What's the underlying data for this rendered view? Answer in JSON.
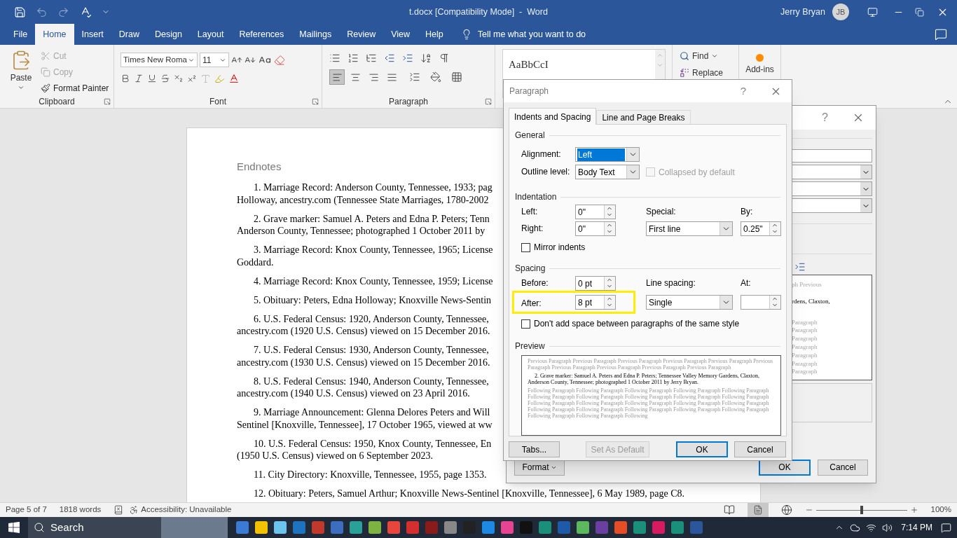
{
  "window": {
    "title": "t.docx [Compatibility Mode]  -  Word",
    "user": "Jerry Bryan",
    "avatar": "JB"
  },
  "ribbon_tabs": [
    {
      "label": "File",
      "selected": false
    },
    {
      "label": "Home",
      "selected": true
    },
    {
      "label": "Insert",
      "selected": false
    },
    {
      "label": "Draw",
      "selected": false
    },
    {
      "label": "Design",
      "selected": false
    },
    {
      "label": "Layout",
      "selected": false
    },
    {
      "label": "References",
      "selected": false
    },
    {
      "label": "Mailings",
      "selected": false
    },
    {
      "label": "Review",
      "selected": false
    },
    {
      "label": "View",
      "selected": false
    },
    {
      "label": "Help",
      "selected": false
    }
  ],
  "tell_me": "Tell me what you want to do",
  "clipboard": {
    "paste": "Paste",
    "cut": {
      "label": "Cut",
      "disabled": true
    },
    "copy": {
      "label": "Copy",
      "disabled": true
    },
    "format_painter": {
      "label": "Format Painter",
      "disabled": false
    },
    "group_label": "Clipboard"
  },
  "font": {
    "name": "Times New Roma",
    "size": "11",
    "group_label": "Font"
  },
  "paragraph": {
    "group_label": "Paragraph",
    "align_buttons": [
      {
        "selected": true
      },
      {
        "selected": false
      },
      {
        "selected": false
      },
      {
        "selected": false
      }
    ]
  },
  "styles": {
    "sample": "AaBbCcI"
  },
  "editing": {
    "find": "Find",
    "replace": "Replace"
  },
  "addins": {
    "label": "Add-ins"
  },
  "document": {
    "heading": "Endnotes",
    "notes": [
      {
        "lines": [
          "1. Marriage Record: Anderson County, Tennessee, 1933; pag",
          "Holloway, ancestry.com (Tennessee State Marriages, 1780-2002"
        ]
      },
      {
        "lines": [
          "2. Grave marker: Samuel A. Peters and Edna P. Peters; Tenn",
          "Anderson County, Tennessee; photographed 1 October 2011 by"
        ]
      },
      {
        "lines": [
          "3. Marriage Record: Knox County, Tennessee, 1965; License",
          "Goddard."
        ]
      },
      {
        "lines": [
          "4. Marriage Record: Knox County, Tennessee, 1959; License"
        ]
      },
      {
        "lines": [
          "5. Obituary: Peters, Edna Holloway; Knoxville News-Sentin"
        ]
      },
      {
        "lines": [
          "6. U.S. Federal Census: 1920, Anderson County, Tennessee,",
          "ancestry.com (1920 U.S. Census) viewed on 15 December 2016."
        ]
      },
      {
        "lines": [
          "7. U.S. Federal Census: 1930, Anderson County, Tennessee,",
          "ancestry.com (1930 U.S. Census) viewed on 15 December 2016."
        ]
      },
      {
        "lines": [
          "8. U.S. Federal Census: 1940, Anderson County, Tennessee,",
          "ancestry.com (1940 U.S. Census) viewed on 23 April 2016."
        ]
      },
      {
        "lines": [
          "9. Marriage Announcement: Glenna Delores Peters and Will",
          "Sentinel [Knoxville, Tennessee], 17 October 1965, viewed at ww"
        ]
      },
      {
        "lines": [
          "10. U.S. Federal Census: 1950, Knox County, Tennessee, En",
          "(1950 U.S. Census) viewed on 6 September 2023."
        ]
      },
      {
        "lines": [
          "11. City Directory: Knoxville, Tennessee, 1955, page 1353."
        ]
      },
      {
        "lines": [
          "12. Obituary: Peters, Samuel Arthur; Knoxville News-Sentinel [Knoxville, Tennessee], 6 May 1989, page C8."
        ]
      }
    ]
  },
  "back_dialog": {
    "help": "?",
    "preview_fragments": [
      {
        "text": "ph Previous",
        "kind": "previous"
      },
      {
        "text": "rdens, Claxton,",
        "kind": "sample"
      },
      {
        "text": "Paragraph",
        "kind": "following"
      },
      {
        "text": "Paragraph",
        "kind": "following"
      },
      {
        "text": "Paragraph",
        "kind": "following"
      },
      {
        "text": "Paragraph",
        "kind": "following"
      },
      {
        "text": "Paragraph",
        "kind": "following"
      },
      {
        "text": "Paragraph",
        "kind": "following"
      },
      {
        "text": "Paragraph",
        "kind": "following"
      }
    ],
    "format": "Format",
    "ok": "OK",
    "cancel": "Cancel"
  },
  "paragraph_dialog": {
    "title": "Paragraph",
    "help": "?",
    "tabs": [
      {
        "label": "Indents and Spacing",
        "selected": true
      },
      {
        "label": "Line and Page Breaks",
        "selected": false
      }
    ],
    "general": {
      "heading": "General",
      "alignment": {
        "label": "Alignment:",
        "value": "Left"
      },
      "outline_level": {
        "label": "Outline level:",
        "value": "Body Text"
      },
      "collapsed": {
        "label": "Collapsed by default",
        "checked": false,
        "disabled": true
      }
    },
    "indentation": {
      "heading": "Indentation",
      "left": {
        "label": "Left:",
        "value": "0\""
      },
      "right": {
        "label": "Right:",
        "value": "0\""
      },
      "special": {
        "label": "Special:",
        "value": "First line"
      },
      "by": {
        "label": "By:",
        "value": "0.25\""
      },
      "mirror": {
        "label": "Mirror indents",
        "checked": false
      }
    },
    "spacing": {
      "heading": "Spacing",
      "before": {
        "label": "Before:",
        "value": "0 pt"
      },
      "after": {
        "label": "After:",
        "value": "8 pt",
        "highlighted": true
      },
      "line_spacing": {
        "label": "Line spacing:",
        "value": "Single"
      },
      "at": {
        "label": "At:"
      },
      "dont_add": {
        "label": "Don't add space between paragraphs of the same style",
        "checked": false
      }
    },
    "preview": {
      "heading": "Preview",
      "previous": "Previous Paragraph Previous Paragraph Previous Paragraph Previous Paragraph Previous Paragraph Previous Paragraph Previous Paragraph Previous Paragraph Previous Paragraph Previous Paragraph",
      "sample": "2. Grave marker: Samuel A. Peters and Edna P. Peters; Tennessee Valley Memory Gardens, Claxton, Anderson County, Tennessee; photographed 1 October 2011 by Jerry Bryan.",
      "following": "Following Paragraph Following Paragraph Following Paragraph Following Paragraph Following Paragraph Following Paragraph Following Paragraph Following Paragraph Following Paragraph Following Paragraph Following Paragraph Following Paragraph Following Paragraph Following Paragraph Following Paragraph Following Paragraph Following Paragraph Following Paragraph Following Paragraph Following Paragraph Following Paragraph Following Paragraph Following"
    },
    "buttons": {
      "tabs": {
        "label": "Tabs...",
        "disabled": false
      },
      "set_default": {
        "label": "Set As Default",
        "disabled": true
      },
      "ok": {
        "label": "OK",
        "disabled": false
      },
      "cancel": {
        "label": "Cancel",
        "disabled": false
      }
    }
  },
  "status_bar": {
    "page": "Page 5 of 7",
    "words": "1818 words",
    "accessibility": "Accessibility: Unavailable",
    "zoom": {
      "level": 0.5,
      "reading": "100%"
    }
  },
  "taskbar": {
    "search": "Search",
    "time": "7:14 PM"
  }
}
